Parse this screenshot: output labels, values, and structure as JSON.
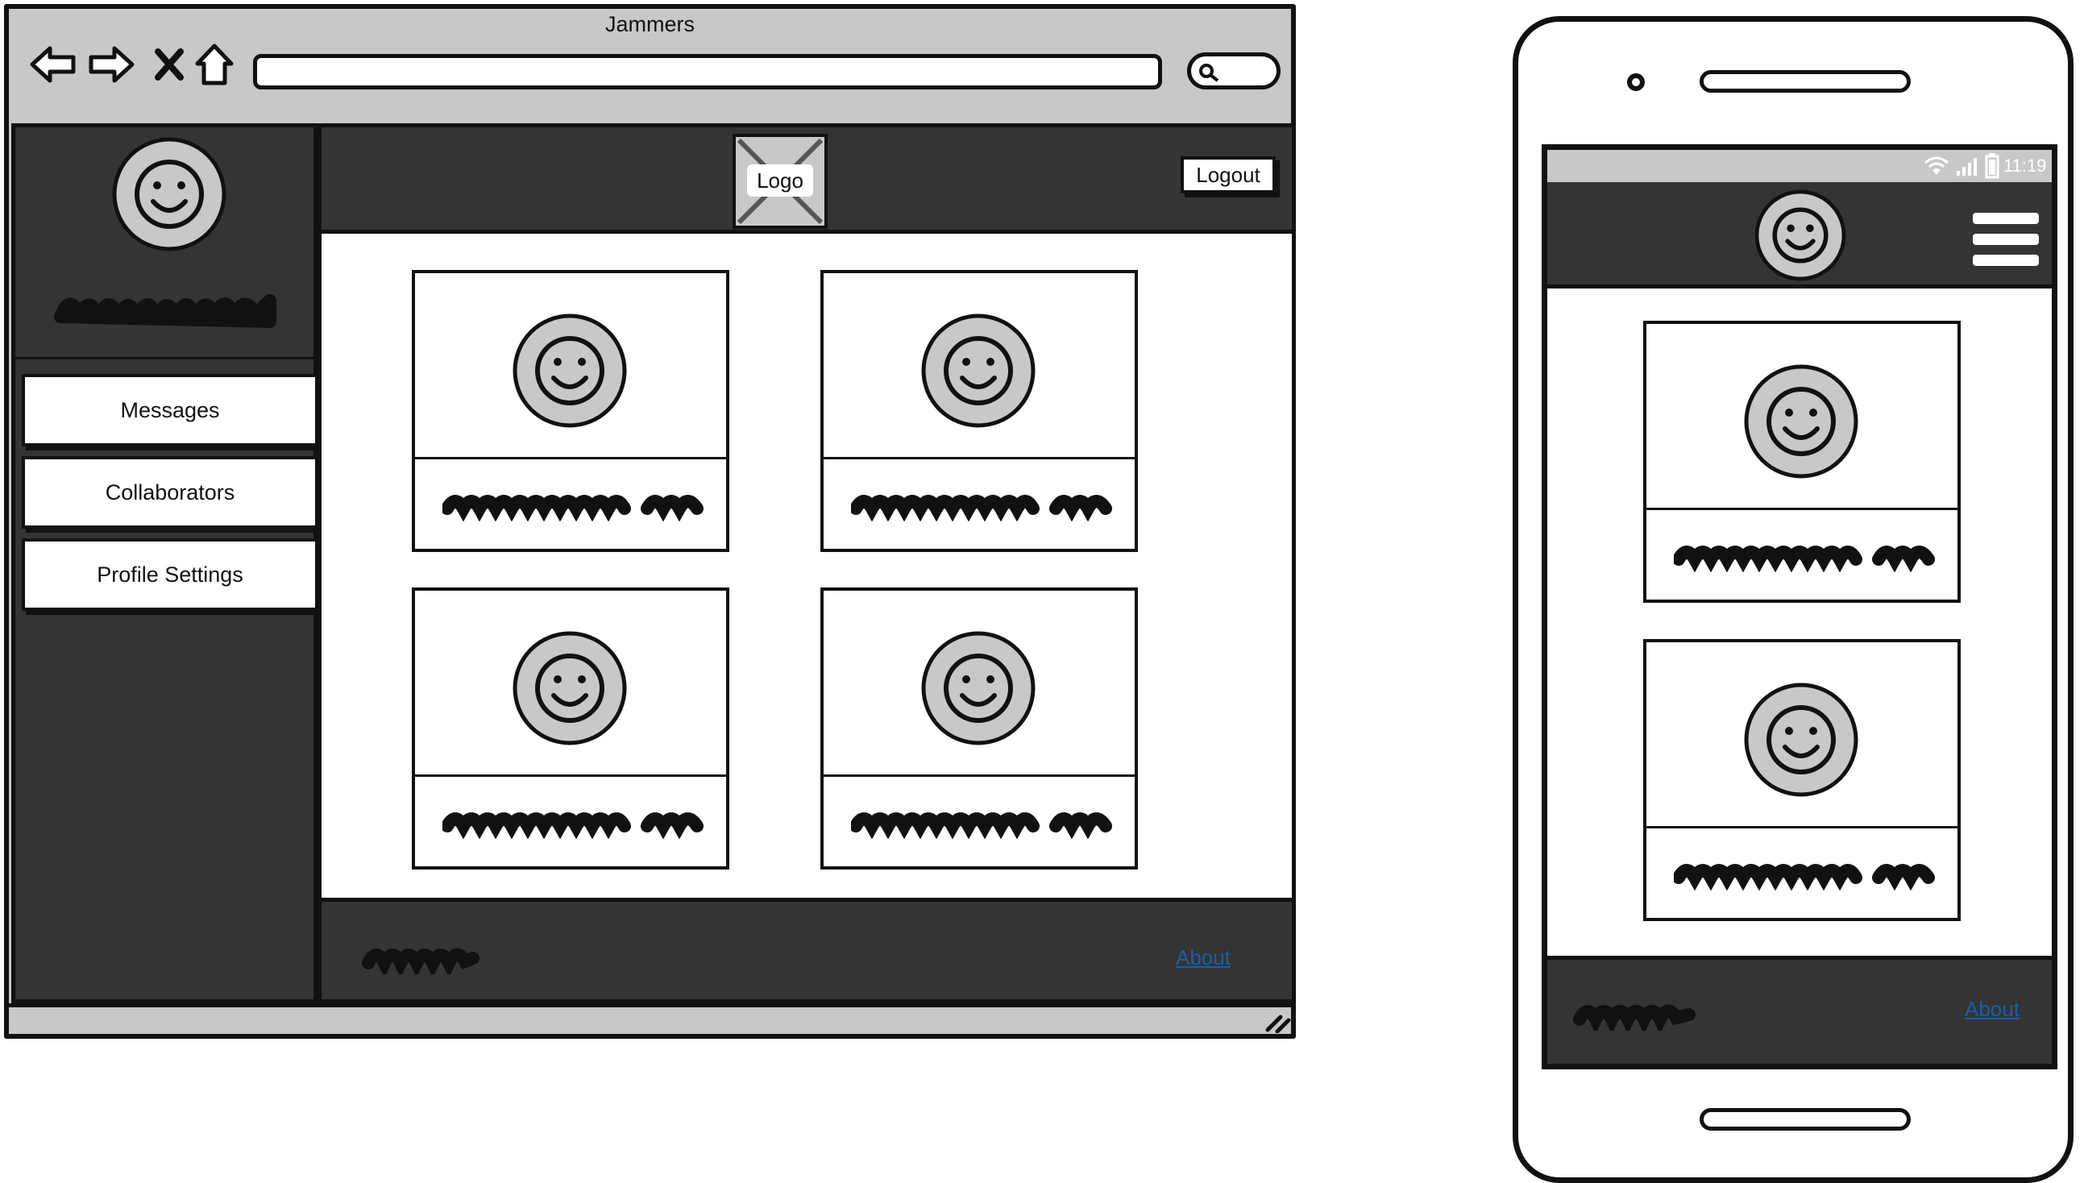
{
  "browser": {
    "title": "Jammers",
    "nav_icons": [
      "back-arrow-icon",
      "forward-arrow-icon",
      "stop-icon",
      "home-icon"
    ],
    "address_bar": {
      "value": ""
    },
    "search_icon": "search-icon"
  },
  "sidebar": {
    "avatar_icon": "smiley-face-icon",
    "items": [
      {
        "label": "Messages"
      },
      {
        "label": "Collaborators"
      },
      {
        "label": "Profile Settings"
      }
    ]
  },
  "header": {
    "logo_label": "Logo",
    "logout_label": "Logout"
  },
  "cards": [
    {
      "avatar_icon": "smiley-face-icon"
    },
    {
      "avatar_icon": "smiley-face-icon"
    },
    {
      "avatar_icon": "smiley-face-icon"
    },
    {
      "avatar_icon": "smiley-face-icon"
    }
  ],
  "footer": {
    "about_label": "About"
  },
  "phone": {
    "status_time": "11:19",
    "status_icons": [
      "wifi-icon",
      "signal-icon",
      "battery-icon"
    ],
    "menu_icon": "hamburger-menu-icon",
    "cards": [
      {
        "avatar_icon": "smiley-face-icon"
      },
      {
        "avatar_icon": "smiley-face-icon"
      }
    ],
    "footer": {
      "about_label": "About"
    }
  },
  "colors": {
    "chrome_gray": "#c8c8c8",
    "dark_panel": "#343434",
    "outline": "#111111",
    "link": "#1a5fa8",
    "white": "#ffffff"
  }
}
